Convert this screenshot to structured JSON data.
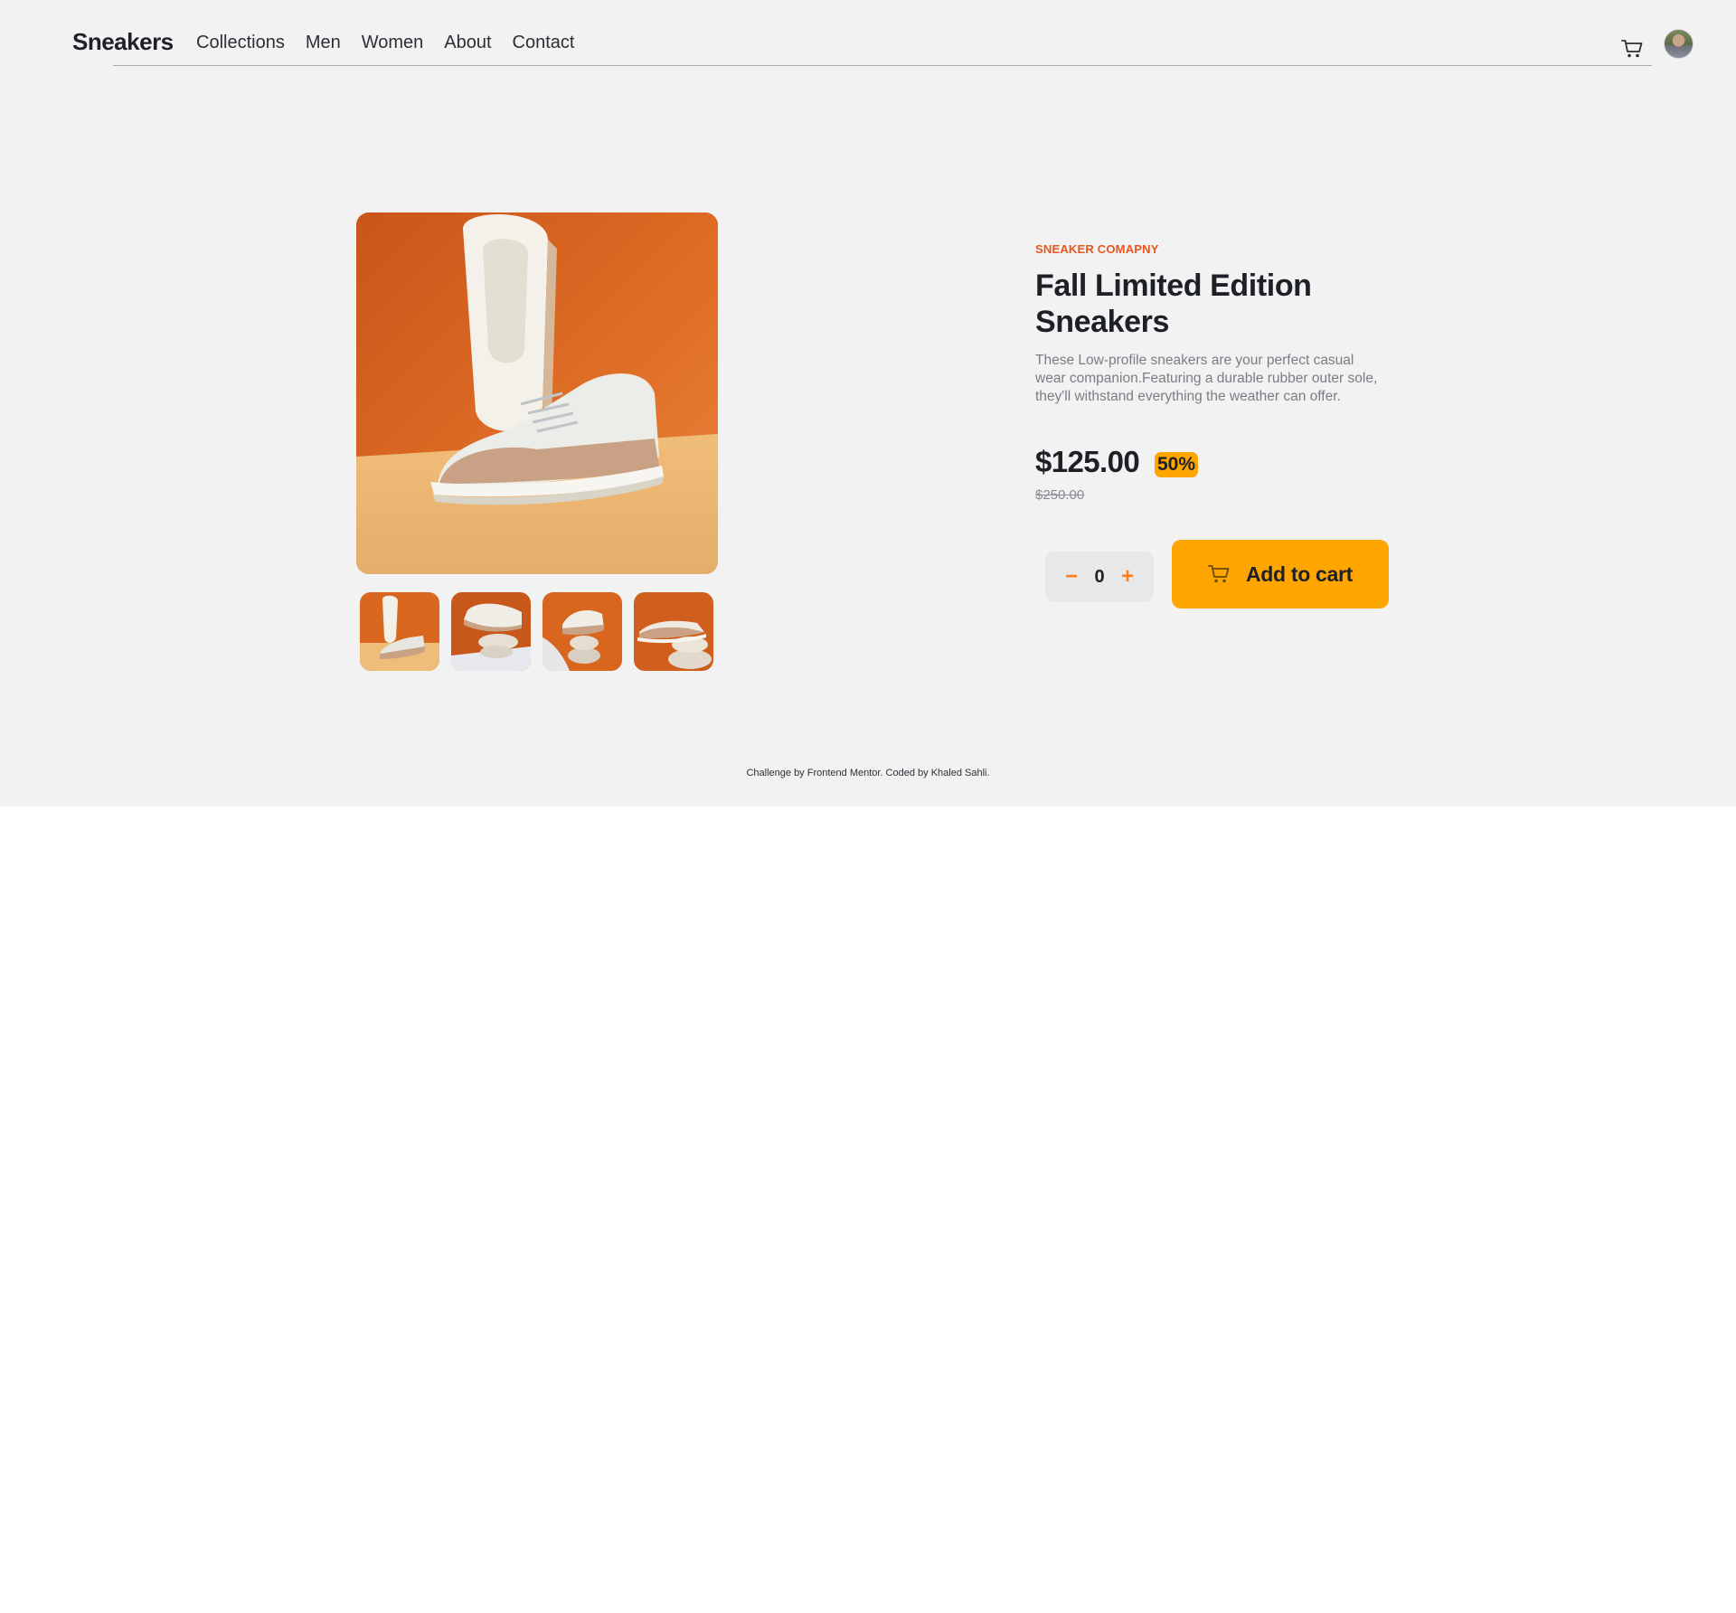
{
  "header": {
    "logo": "Sneakers",
    "nav": [
      "Collections",
      "Men",
      "Women",
      "About",
      "Contact"
    ],
    "cart_icon": "cart-icon",
    "avatar_icon": "avatar"
  },
  "product": {
    "company": "SNEAKER COMAPNY",
    "title": "Fall Limited Edition Sneakers",
    "description": "These Low-profile sneakers are your perfect casual wear companion.Featuring a durable rubber outer sole, they'll withstand everything the weather can offer.",
    "price": "$125.00",
    "discount": "50%",
    "original_price": "$250.00"
  },
  "cart_controls": {
    "decrement": "−",
    "quantity": "0",
    "increment": "+",
    "add_label": "Add to cart"
  },
  "footer": {
    "text": "Challenge by Frontend Mentor. Coded by Khaled Sahli."
  },
  "colors": {
    "accent": "#ffa500",
    "brand_orange": "#e8561e",
    "background": "#f2f2f2"
  }
}
